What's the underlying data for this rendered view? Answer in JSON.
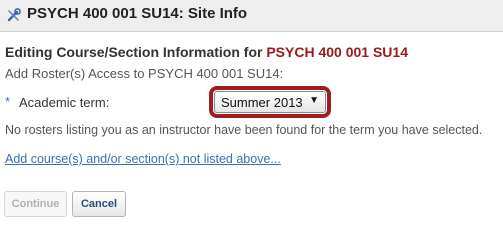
{
  "header": {
    "title": "PSYCH 400 001 SU14: Site Info",
    "icon": "tools-icon"
  },
  "form": {
    "heading_prefix": "Editing Course/Section Information for",
    "heading_site": "PSYCH 400 001 SU14",
    "subheading": "Add Roster(s) Access to PSYCH 400 001 SU14:",
    "required_mark": "*",
    "term_label": "Academic term:",
    "term_selected": "Summer 2013",
    "notice": "No rosters listing you as an instructor have been found for the term you have selected.",
    "add_link": "Add course(s) and/or section(s) not listed above..."
  },
  "buttons": {
    "continue_label": "Continue",
    "cancel_label": "Cancel"
  },
  "colors": {
    "site_code": "#9b1b17",
    "link": "#3b6fb6",
    "highlight": "#a11d1d"
  }
}
